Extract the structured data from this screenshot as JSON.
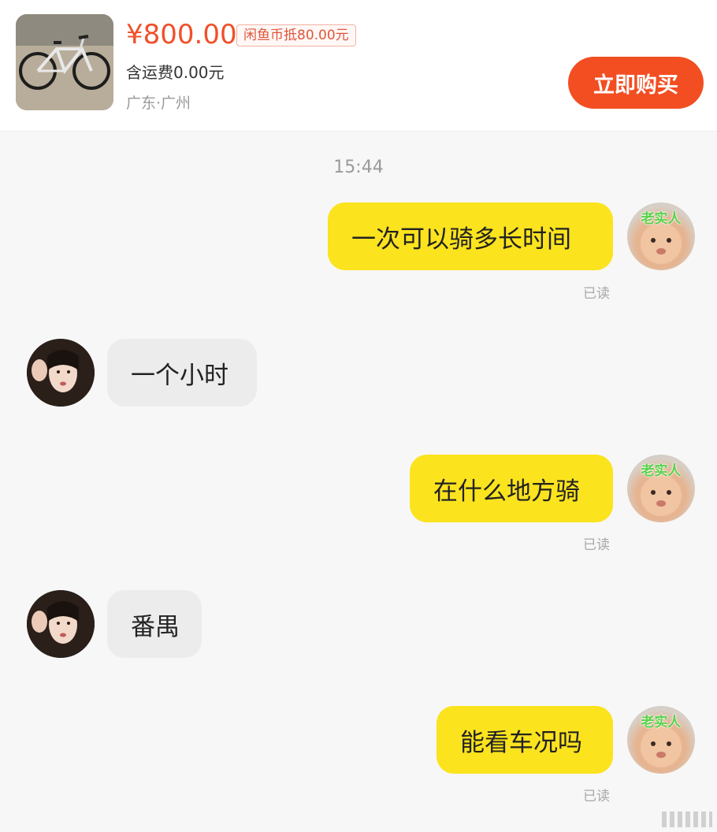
{
  "product": {
    "price": "¥800.00",
    "coin_discount": "闲鱼币抵80.00元",
    "shipping": "含运费0.00元",
    "location": "广东·广州",
    "buy_label": "立即购买"
  },
  "chat": {
    "timestamp": "15:44",
    "me_avatar_tag": "老实人",
    "messages": [
      {
        "from": "me",
        "text": "一次可以骑多长时间",
        "status": "已读"
      },
      {
        "from": "seller",
        "text": "一个小时"
      },
      {
        "from": "me",
        "text": "在什么地方骑",
        "status": "已读"
      },
      {
        "from": "seller",
        "text": "番禺"
      },
      {
        "from": "me",
        "text": "能看车况吗",
        "status": "已读"
      }
    ]
  },
  "colors": {
    "accent": "#f24e22",
    "price": "#f0502a",
    "outgoing_bubble": "#fbe31e",
    "incoming_bubble": "#ececec"
  }
}
